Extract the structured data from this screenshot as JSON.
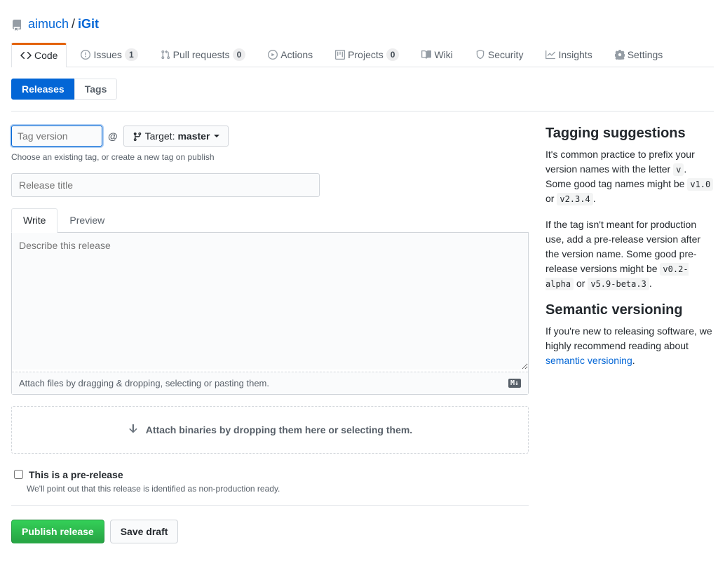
{
  "breadcrumb": {
    "owner": "aimuch",
    "repo": "iGit"
  },
  "navTabs": [
    {
      "label": "Code",
      "icon": "code",
      "selected": true
    },
    {
      "label": "Issues",
      "icon": "issue",
      "count": "1"
    },
    {
      "label": "Pull requests",
      "icon": "pr",
      "count": "0"
    },
    {
      "label": "Actions",
      "icon": "play"
    },
    {
      "label": "Projects",
      "icon": "project",
      "count": "0"
    },
    {
      "label": "Wiki",
      "icon": "book"
    },
    {
      "label": "Security",
      "icon": "shield"
    },
    {
      "label": "Insights",
      "icon": "graph"
    },
    {
      "label": "Settings",
      "icon": "gear"
    }
  ],
  "subnav": {
    "releases": "Releases",
    "tags": "Tags"
  },
  "form": {
    "tagPlaceholder": "Tag version",
    "atSymbol": "@",
    "targetLabel": "Target:",
    "targetBranch": "master",
    "tagHint": "Choose an existing tag, or create a new tag on publish",
    "titlePlaceholder": "Release title",
    "writeTab": "Write",
    "previewTab": "Preview",
    "descPlaceholder": "Describe this release",
    "attachText": "Attach files by dragging & dropping, selecting or pasting them.",
    "mdBadge": "M↓",
    "dropzone": "Attach binaries by dropping them here or selecting them.",
    "prereleaseLabel": "This is a pre-release",
    "prereleaseSub": "We'll point out that this release is identified as non-production ready.",
    "publishBtn": "Publish release",
    "draftBtn": "Save draft"
  },
  "sidebar": {
    "tagging": {
      "title": "Tagging suggestions",
      "p1a": "It's common practice to prefix your version names with the letter ",
      "p1c1": "v",
      "p1b": ". Some good tag names might be ",
      "p1c2": "v1.0",
      "p1or": " or ",
      "p1c3": "v2.3.4",
      "p1end": ".",
      "p2a": "If the tag isn't meant for production use, add a pre-release version after the version name. Some good pre-release versions might be ",
      "p2c1": "v0.2-alpha",
      "p2or": " or ",
      "p2c2": "v5.9-beta.3",
      "p2end": "."
    },
    "semver": {
      "title": "Semantic versioning",
      "text": "If you're new to releasing software, we highly recommend reading about ",
      "link": "semantic versioning",
      "end": "."
    }
  }
}
